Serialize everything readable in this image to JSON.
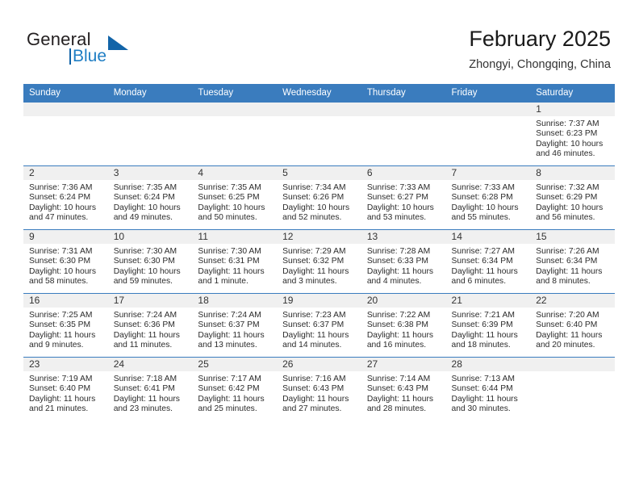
{
  "brand": {
    "name_part1": "General",
    "name_part2": "Blue",
    "accent_color": "#1264a8"
  },
  "header": {
    "title": "February 2025",
    "location": "Zhongyi, Chongqing, China"
  },
  "theme": {
    "header_blue": "#3a7cbe",
    "daynum_band": "#f0f0f0",
    "text": "#2b2b2b"
  },
  "weekday_headers": [
    "Sunday",
    "Monday",
    "Tuesday",
    "Wednesday",
    "Thursday",
    "Friday",
    "Saturday"
  ],
  "weeks": [
    [
      {
        "day": "",
        "blank": true,
        "sunrise": "",
        "sunset": "",
        "daylight": ""
      },
      {
        "day": "",
        "blank": true,
        "sunrise": "",
        "sunset": "",
        "daylight": ""
      },
      {
        "day": "",
        "blank": true,
        "sunrise": "",
        "sunset": "",
        "daylight": ""
      },
      {
        "day": "",
        "blank": true,
        "sunrise": "",
        "sunset": "",
        "daylight": ""
      },
      {
        "day": "",
        "blank": true,
        "sunrise": "",
        "sunset": "",
        "daylight": ""
      },
      {
        "day": "",
        "blank": true,
        "sunrise": "",
        "sunset": "",
        "daylight": ""
      },
      {
        "day": "1",
        "blank": false,
        "sunrise": "Sunrise: 7:37 AM",
        "sunset": "Sunset: 6:23 PM",
        "daylight": "Daylight: 10 hours and 46 minutes."
      }
    ],
    [
      {
        "day": "2",
        "blank": false,
        "sunrise": "Sunrise: 7:36 AM",
        "sunset": "Sunset: 6:24 PM",
        "daylight": "Daylight: 10 hours and 47 minutes."
      },
      {
        "day": "3",
        "blank": false,
        "sunrise": "Sunrise: 7:35 AM",
        "sunset": "Sunset: 6:24 PM",
        "daylight": "Daylight: 10 hours and 49 minutes."
      },
      {
        "day": "4",
        "blank": false,
        "sunrise": "Sunrise: 7:35 AM",
        "sunset": "Sunset: 6:25 PM",
        "daylight": "Daylight: 10 hours and 50 minutes."
      },
      {
        "day": "5",
        "blank": false,
        "sunrise": "Sunrise: 7:34 AM",
        "sunset": "Sunset: 6:26 PM",
        "daylight": "Daylight: 10 hours and 52 minutes."
      },
      {
        "day": "6",
        "blank": false,
        "sunrise": "Sunrise: 7:33 AM",
        "sunset": "Sunset: 6:27 PM",
        "daylight": "Daylight: 10 hours and 53 minutes."
      },
      {
        "day": "7",
        "blank": false,
        "sunrise": "Sunrise: 7:33 AM",
        "sunset": "Sunset: 6:28 PM",
        "daylight": "Daylight: 10 hours and 55 minutes."
      },
      {
        "day": "8",
        "blank": false,
        "sunrise": "Sunrise: 7:32 AM",
        "sunset": "Sunset: 6:29 PM",
        "daylight": "Daylight: 10 hours and 56 minutes."
      }
    ],
    [
      {
        "day": "9",
        "blank": false,
        "sunrise": "Sunrise: 7:31 AM",
        "sunset": "Sunset: 6:30 PM",
        "daylight": "Daylight: 10 hours and 58 minutes."
      },
      {
        "day": "10",
        "blank": false,
        "sunrise": "Sunrise: 7:30 AM",
        "sunset": "Sunset: 6:30 PM",
        "daylight": "Daylight: 10 hours and 59 minutes."
      },
      {
        "day": "11",
        "blank": false,
        "sunrise": "Sunrise: 7:30 AM",
        "sunset": "Sunset: 6:31 PM",
        "daylight": "Daylight: 11 hours and 1 minute."
      },
      {
        "day": "12",
        "blank": false,
        "sunrise": "Sunrise: 7:29 AM",
        "sunset": "Sunset: 6:32 PM",
        "daylight": "Daylight: 11 hours and 3 minutes."
      },
      {
        "day": "13",
        "blank": false,
        "sunrise": "Sunrise: 7:28 AM",
        "sunset": "Sunset: 6:33 PM",
        "daylight": "Daylight: 11 hours and 4 minutes."
      },
      {
        "day": "14",
        "blank": false,
        "sunrise": "Sunrise: 7:27 AM",
        "sunset": "Sunset: 6:34 PM",
        "daylight": "Daylight: 11 hours and 6 minutes."
      },
      {
        "day": "15",
        "blank": false,
        "sunrise": "Sunrise: 7:26 AM",
        "sunset": "Sunset: 6:34 PM",
        "daylight": "Daylight: 11 hours and 8 minutes."
      }
    ],
    [
      {
        "day": "16",
        "blank": false,
        "sunrise": "Sunrise: 7:25 AM",
        "sunset": "Sunset: 6:35 PM",
        "daylight": "Daylight: 11 hours and 9 minutes."
      },
      {
        "day": "17",
        "blank": false,
        "sunrise": "Sunrise: 7:24 AM",
        "sunset": "Sunset: 6:36 PM",
        "daylight": "Daylight: 11 hours and 11 minutes."
      },
      {
        "day": "18",
        "blank": false,
        "sunrise": "Sunrise: 7:24 AM",
        "sunset": "Sunset: 6:37 PM",
        "daylight": "Daylight: 11 hours and 13 minutes."
      },
      {
        "day": "19",
        "blank": false,
        "sunrise": "Sunrise: 7:23 AM",
        "sunset": "Sunset: 6:37 PM",
        "daylight": "Daylight: 11 hours and 14 minutes."
      },
      {
        "day": "20",
        "blank": false,
        "sunrise": "Sunrise: 7:22 AM",
        "sunset": "Sunset: 6:38 PM",
        "daylight": "Daylight: 11 hours and 16 minutes."
      },
      {
        "day": "21",
        "blank": false,
        "sunrise": "Sunrise: 7:21 AM",
        "sunset": "Sunset: 6:39 PM",
        "daylight": "Daylight: 11 hours and 18 minutes."
      },
      {
        "day": "22",
        "blank": false,
        "sunrise": "Sunrise: 7:20 AM",
        "sunset": "Sunset: 6:40 PM",
        "daylight": "Daylight: 11 hours and 20 minutes."
      }
    ],
    [
      {
        "day": "23",
        "blank": false,
        "sunrise": "Sunrise: 7:19 AM",
        "sunset": "Sunset: 6:40 PM",
        "daylight": "Daylight: 11 hours and 21 minutes."
      },
      {
        "day": "24",
        "blank": false,
        "sunrise": "Sunrise: 7:18 AM",
        "sunset": "Sunset: 6:41 PM",
        "daylight": "Daylight: 11 hours and 23 minutes."
      },
      {
        "day": "25",
        "blank": false,
        "sunrise": "Sunrise: 7:17 AM",
        "sunset": "Sunset: 6:42 PM",
        "daylight": "Daylight: 11 hours and 25 minutes."
      },
      {
        "day": "26",
        "blank": false,
        "sunrise": "Sunrise: 7:16 AM",
        "sunset": "Sunset: 6:43 PM",
        "daylight": "Daylight: 11 hours and 27 minutes."
      },
      {
        "day": "27",
        "blank": false,
        "sunrise": "Sunrise: 7:14 AM",
        "sunset": "Sunset: 6:43 PM",
        "daylight": "Daylight: 11 hours and 28 minutes."
      },
      {
        "day": "28",
        "blank": false,
        "sunrise": "Sunrise: 7:13 AM",
        "sunset": "Sunset: 6:44 PM",
        "daylight": "Daylight: 11 hours and 30 minutes."
      },
      {
        "day": "",
        "blank": true,
        "sunrise": "",
        "sunset": "",
        "daylight": ""
      }
    ]
  ]
}
